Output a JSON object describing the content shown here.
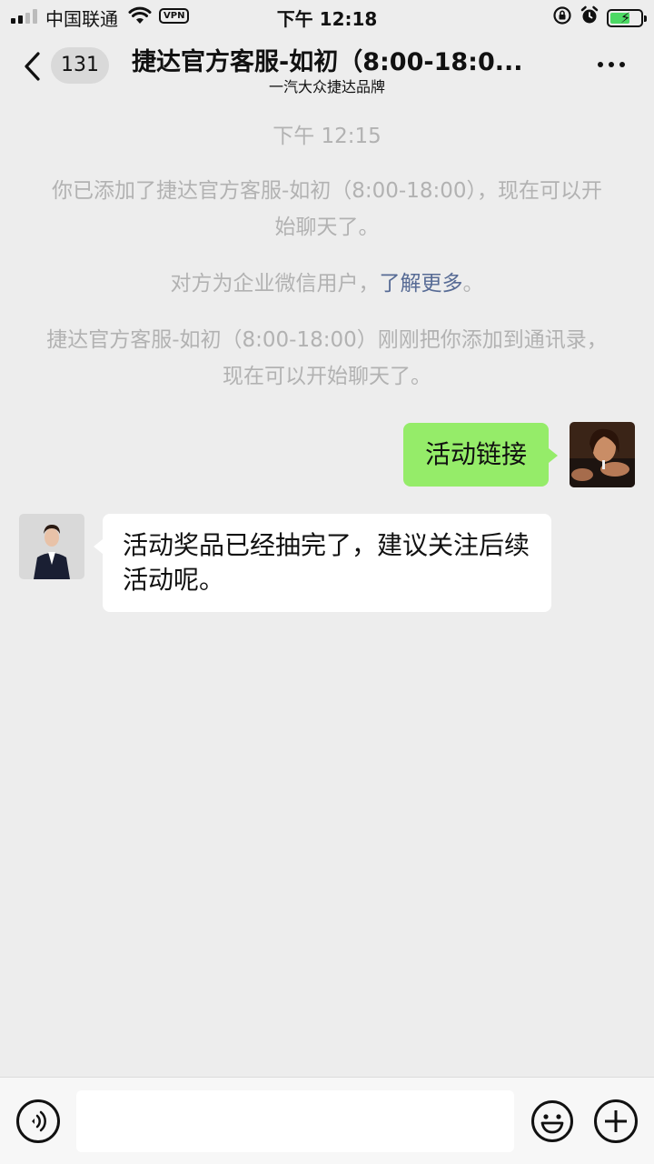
{
  "status_bar": {
    "carrier": "中国联通",
    "vpn": "VPN",
    "time": "下午 12:18"
  },
  "nav": {
    "unread_count": "131",
    "title": "捷达官方客服-如初（8:00-18:0...",
    "subtitle": "一汽大众捷达品牌"
  },
  "messages": {
    "timestamp": "下午 12:15",
    "sys_added": "你已添加了捷达官方客服-如初（8:00-18:00），现在可以开始聊天了。",
    "sys_enterprise_prefix": "对方为企业微信用户，",
    "sys_enterprise_link": "了解更多",
    "sys_enterprise_suffix": "。",
    "sys_contact": "捷达官方客服-如初（8:00-18:00）刚刚把你添加到通讯录，现在可以开始聊天了。",
    "me_text": "活动链接",
    "them_text": "活动奖品已经抽完了，建议关注后续活动呢。"
  },
  "input": {
    "placeholder": ""
  },
  "colors": {
    "background": "#ededed",
    "my_bubble": "#95ec69",
    "their_bubble": "#ffffff",
    "link": "#576b95",
    "system_text": "#b2b2b2"
  },
  "icons": [
    "back-chevron-icon",
    "more-dots-icon",
    "voice-icon",
    "emoji-icon",
    "plus-icon",
    "wifi-icon",
    "alarm-icon",
    "orientation-lock-icon",
    "battery-icon"
  ]
}
